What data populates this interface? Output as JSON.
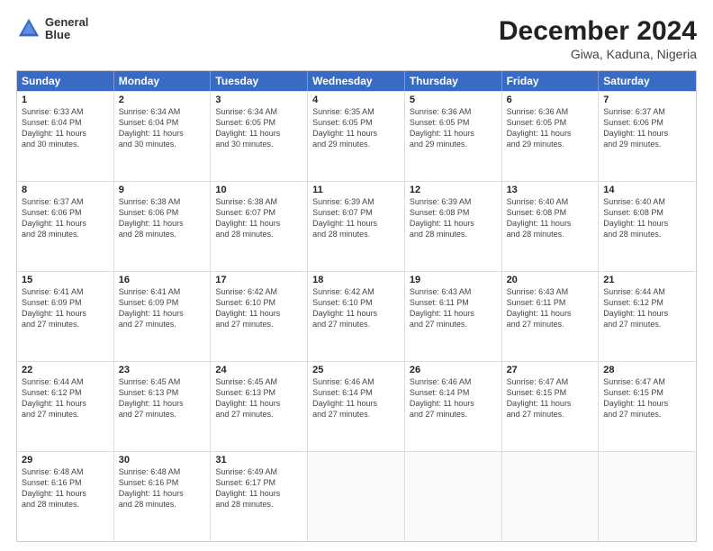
{
  "header": {
    "logo_line1": "General",
    "logo_line2": "Blue",
    "title": "December 2024",
    "subtitle": "Giwa, Kaduna, Nigeria"
  },
  "days_of_week": [
    "Sunday",
    "Monday",
    "Tuesday",
    "Wednesday",
    "Thursday",
    "Friday",
    "Saturday"
  ],
  "weeks": [
    [
      {
        "day": "1",
        "info": "Sunrise: 6:33 AM\nSunset: 6:04 PM\nDaylight: 11 hours\nand 30 minutes."
      },
      {
        "day": "2",
        "info": "Sunrise: 6:34 AM\nSunset: 6:04 PM\nDaylight: 11 hours\nand 30 minutes."
      },
      {
        "day": "3",
        "info": "Sunrise: 6:34 AM\nSunset: 6:05 PM\nDaylight: 11 hours\nand 30 minutes."
      },
      {
        "day": "4",
        "info": "Sunrise: 6:35 AM\nSunset: 6:05 PM\nDaylight: 11 hours\nand 29 minutes."
      },
      {
        "day": "5",
        "info": "Sunrise: 6:36 AM\nSunset: 6:05 PM\nDaylight: 11 hours\nand 29 minutes."
      },
      {
        "day": "6",
        "info": "Sunrise: 6:36 AM\nSunset: 6:05 PM\nDaylight: 11 hours\nand 29 minutes."
      },
      {
        "day": "7",
        "info": "Sunrise: 6:37 AM\nSunset: 6:06 PM\nDaylight: 11 hours\nand 29 minutes."
      }
    ],
    [
      {
        "day": "8",
        "info": "Sunrise: 6:37 AM\nSunset: 6:06 PM\nDaylight: 11 hours\nand 28 minutes."
      },
      {
        "day": "9",
        "info": "Sunrise: 6:38 AM\nSunset: 6:06 PM\nDaylight: 11 hours\nand 28 minutes."
      },
      {
        "day": "10",
        "info": "Sunrise: 6:38 AM\nSunset: 6:07 PM\nDaylight: 11 hours\nand 28 minutes."
      },
      {
        "day": "11",
        "info": "Sunrise: 6:39 AM\nSunset: 6:07 PM\nDaylight: 11 hours\nand 28 minutes."
      },
      {
        "day": "12",
        "info": "Sunrise: 6:39 AM\nSunset: 6:08 PM\nDaylight: 11 hours\nand 28 minutes."
      },
      {
        "day": "13",
        "info": "Sunrise: 6:40 AM\nSunset: 6:08 PM\nDaylight: 11 hours\nand 28 minutes."
      },
      {
        "day": "14",
        "info": "Sunrise: 6:40 AM\nSunset: 6:08 PM\nDaylight: 11 hours\nand 28 minutes."
      }
    ],
    [
      {
        "day": "15",
        "info": "Sunrise: 6:41 AM\nSunset: 6:09 PM\nDaylight: 11 hours\nand 27 minutes."
      },
      {
        "day": "16",
        "info": "Sunrise: 6:41 AM\nSunset: 6:09 PM\nDaylight: 11 hours\nand 27 minutes."
      },
      {
        "day": "17",
        "info": "Sunrise: 6:42 AM\nSunset: 6:10 PM\nDaylight: 11 hours\nand 27 minutes."
      },
      {
        "day": "18",
        "info": "Sunrise: 6:42 AM\nSunset: 6:10 PM\nDaylight: 11 hours\nand 27 minutes."
      },
      {
        "day": "19",
        "info": "Sunrise: 6:43 AM\nSunset: 6:11 PM\nDaylight: 11 hours\nand 27 minutes."
      },
      {
        "day": "20",
        "info": "Sunrise: 6:43 AM\nSunset: 6:11 PM\nDaylight: 11 hours\nand 27 minutes."
      },
      {
        "day": "21",
        "info": "Sunrise: 6:44 AM\nSunset: 6:12 PM\nDaylight: 11 hours\nand 27 minutes."
      }
    ],
    [
      {
        "day": "22",
        "info": "Sunrise: 6:44 AM\nSunset: 6:12 PM\nDaylight: 11 hours\nand 27 minutes."
      },
      {
        "day": "23",
        "info": "Sunrise: 6:45 AM\nSunset: 6:13 PM\nDaylight: 11 hours\nand 27 minutes."
      },
      {
        "day": "24",
        "info": "Sunrise: 6:45 AM\nSunset: 6:13 PM\nDaylight: 11 hours\nand 27 minutes."
      },
      {
        "day": "25",
        "info": "Sunrise: 6:46 AM\nSunset: 6:14 PM\nDaylight: 11 hours\nand 27 minutes."
      },
      {
        "day": "26",
        "info": "Sunrise: 6:46 AM\nSunset: 6:14 PM\nDaylight: 11 hours\nand 27 minutes."
      },
      {
        "day": "27",
        "info": "Sunrise: 6:47 AM\nSunset: 6:15 PM\nDaylight: 11 hours\nand 27 minutes."
      },
      {
        "day": "28",
        "info": "Sunrise: 6:47 AM\nSunset: 6:15 PM\nDaylight: 11 hours\nand 27 minutes."
      }
    ],
    [
      {
        "day": "29",
        "info": "Sunrise: 6:48 AM\nSunset: 6:16 PM\nDaylight: 11 hours\nand 28 minutes."
      },
      {
        "day": "30",
        "info": "Sunrise: 6:48 AM\nSunset: 6:16 PM\nDaylight: 11 hours\nand 28 minutes."
      },
      {
        "day": "31",
        "info": "Sunrise: 6:49 AM\nSunset: 6:17 PM\nDaylight: 11 hours\nand 28 minutes."
      },
      {
        "day": "",
        "info": ""
      },
      {
        "day": "",
        "info": ""
      },
      {
        "day": "",
        "info": ""
      },
      {
        "day": "",
        "info": ""
      }
    ]
  ]
}
